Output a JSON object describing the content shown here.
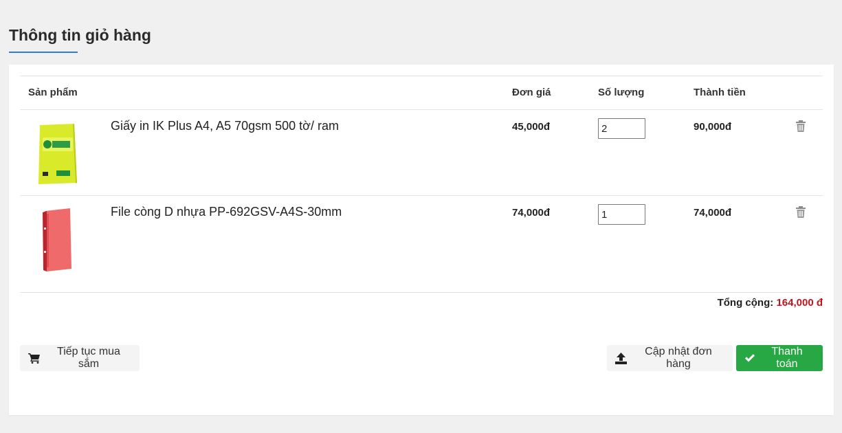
{
  "page": {
    "title": "Thông tin giỏ hàng"
  },
  "table": {
    "headers": {
      "product": "Sản phẩm",
      "price": "Đơn giá",
      "quantity": "Số lượng",
      "total": "Thành tiền"
    },
    "items": [
      {
        "name": "Giấy in IK Plus A4, A5 70gsm 500 tờ/ ram",
        "price": "45,000đ",
        "quantity": "2",
        "total": "90,000đ"
      },
      {
        "name": "File còng D nhựa PP-692GSV-A4S-30mm",
        "price": "74,000đ",
        "quantity": "1",
        "total": "74,000đ"
      }
    ]
  },
  "summary": {
    "label": "Tổng cộng:",
    "amount": "164,000 đ"
  },
  "buttons": {
    "continue_shopping": "Tiếp tục mua sắm",
    "update_order": "Cập nhật đơn hàng",
    "checkout": "Thanh toán"
  },
  "colors": {
    "accent": "#2b7fd1",
    "total_red": "#c0151d",
    "checkout_green": "#28a745"
  },
  "icons": {
    "delete": "trash-icon",
    "cart": "cart-icon",
    "upload": "upload-icon",
    "check": "check-icon"
  }
}
